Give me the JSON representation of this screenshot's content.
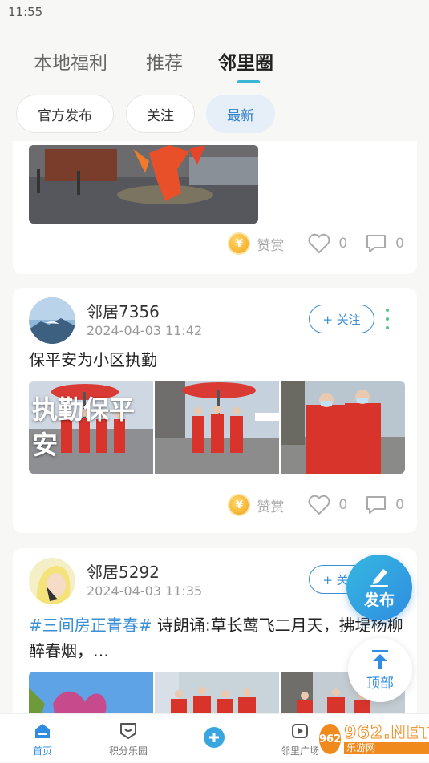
{
  "status_bar": {
    "time": "11:55"
  },
  "top_tabs": [
    {
      "label": "本地福利",
      "active": false
    },
    {
      "label": "推荐",
      "active": false
    },
    {
      "label": "邻里圈",
      "active": true
    }
  ],
  "filter_chips": [
    {
      "label": "官方发布",
      "active": false
    },
    {
      "label": "关注",
      "active": false
    },
    {
      "label": "最新",
      "active": true
    }
  ],
  "posts": [
    {
      "reward_label": "赞赏",
      "likes": "0",
      "comments": "0"
    },
    {
      "username": "邻居7356",
      "timestamp": "2024-04-03 11:42",
      "follow_label": "+ 关注",
      "text": "保平安为小区执勤",
      "image_overlay_text": "执勤保平安",
      "reward_label": "赞赏",
      "likes": "0",
      "comments": "0"
    },
    {
      "username": "邻居5292",
      "timestamp": "2024-04-03 11:35",
      "follow_label": "+ 关注",
      "hashtag": "#三间房正青春#",
      "text": " 诗朗诵:草长莺飞二月天，拂堤杨柳醉春烟，…"
    }
  ],
  "fab": {
    "publish_label": "发布",
    "top_label": "顶部"
  },
  "bottom_nav": [
    {
      "label": "首页",
      "active": true,
      "icon": "home-icon"
    },
    {
      "label": "积分乐园",
      "active": false,
      "icon": "points-icon"
    },
    {
      "label": "",
      "active": false,
      "icon": "plus-icon"
    },
    {
      "label": "邻里广场",
      "active": false,
      "icon": "square-icon"
    }
  ],
  "watermark": {
    "main": "962.NET",
    "sub": "乐游网"
  },
  "colors": {
    "accent": "#2f8ce0",
    "active_chip_bg": "#e6eef8",
    "hashtag": "#3a8fd6",
    "page_bg": "#f7f7f5"
  }
}
